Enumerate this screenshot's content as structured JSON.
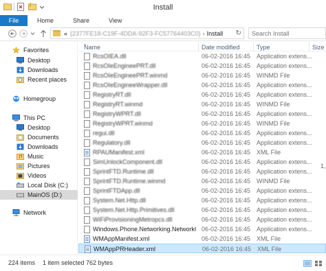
{
  "window": {
    "title": "Install"
  },
  "quick_access": {
    "items": [
      {
        "icon": "explorer-icon"
      },
      {
        "icon": "properties-icon"
      },
      {
        "icon": "new-folder-icon"
      },
      {
        "icon": "dropdown-icon"
      }
    ]
  },
  "ribbon": {
    "file_tab": "File",
    "tabs": [
      "Home",
      "Share",
      "View"
    ]
  },
  "address": {
    "back_icon": "back-arrow-icon",
    "forward_icon": "forward-arrow-icon",
    "up_icon": "up-arrow-icon",
    "overflow": "«",
    "crumb_hidden": "{2377FE18-C19F-4DDA-92F3-FC57764403C0}",
    "crumb": "Install",
    "search_placeholder": "Search Install"
  },
  "sidebar": {
    "favorites": "Favorites",
    "fav_items": [
      "Desktop",
      "Downloads",
      "Recent places"
    ],
    "homegroup": "Homegroup",
    "thispc": "This PC",
    "pc_items": [
      "Desktop",
      "Documents",
      "Downloads",
      "Music",
      "Pictures",
      "Videos",
      "Local Disk (C:)",
      "MainOS (D:)"
    ],
    "network": "Network"
  },
  "columns": {
    "name": "Name",
    "date": "Date modified",
    "type": "Type",
    "size": "Size"
  },
  "files": [
    {
      "name": "RcsOIEA.dll",
      "date": "06-02-2016 16:45",
      "type": "Application extens...",
      "blur": true,
      "xml": false
    },
    {
      "name": "RcsOIeEngineePRT.dll",
      "date": "06-02-2016 16:45",
      "type": "Application extens...",
      "blur": true,
      "xml": false
    },
    {
      "name": "RcsOIeEngineePRT.winmd",
      "date": "06-02-2016 16:45",
      "type": "WINMD File",
      "blur": true,
      "xml": false
    },
    {
      "name": "RcsOIeEngineeWrapper.dll",
      "date": "06-02-2016 16:45",
      "type": "Application extens...",
      "blur": true,
      "xml": false
    },
    {
      "name": "RegistryRT.dll",
      "date": "06-02-2016 16:45",
      "type": "Application extens...",
      "blur": true,
      "xml": false
    },
    {
      "name": "RegistryRT.winmd",
      "date": "06-02-2016 16:45",
      "type": "WINMD File",
      "blur": true,
      "xml": false
    },
    {
      "name": "RegistryWPRT.dll",
      "date": "06-02-2016 16:45",
      "type": "Application extens...",
      "blur": true,
      "xml": false
    },
    {
      "name": "RegistryWPRT.winmd",
      "date": "06-02-2016 16:45",
      "type": "WINMD File",
      "blur": true,
      "xml": false
    },
    {
      "name": "regui.dll",
      "date": "06-02-2016 16:45",
      "type": "Application extens...",
      "blur": true,
      "xml": false
    },
    {
      "name": "Regulatory.dll",
      "date": "06-02-2016 16:45",
      "type": "Application extens...",
      "blur": true,
      "xml": false
    },
    {
      "name": "RPAUManifest.xml",
      "date": "06-02-2016 16:45",
      "type": "XML File",
      "blur": true,
      "xml": true
    },
    {
      "name": "SimUnlockComponent.dll",
      "date": "06-02-2016 16:45",
      "type": "Application extens...",
      "blur": true,
      "xml": false
    },
    {
      "name": "SprintFTD.Runtime.dll",
      "date": "06-02-2016 16:45",
      "type": "Application extens...",
      "blur": true,
      "xml": false
    },
    {
      "name": "SprintFTD.Runtime.winmd",
      "date": "06-02-2016 16:45",
      "type": "WINMD File",
      "blur": true,
      "xml": false
    },
    {
      "name": "SprintFTDApp.dll",
      "date": "06-02-2016 16:45",
      "type": "Application extens...",
      "blur": true,
      "xml": false
    },
    {
      "name": "System.Net.Http.dll",
      "date": "06-02-2016 16:45",
      "type": "Application extens...",
      "blur": true,
      "xml": false
    },
    {
      "name": "System.Net.Http.Primitives.dll",
      "date": "06-02-2016 16:45",
      "type": "Application extens...",
      "blur": true,
      "xml": false
    },
    {
      "name": "WiFiProvisioningMetropcs.dll",
      "date": "06-02-2016 16:45",
      "type": "Application extens...",
      "blur": true,
      "xml": false
    },
    {
      "name": "Windows.Phone.Networking.NetworkOp...",
      "date": "06-02-2016 16:45",
      "type": "Application extens...",
      "blur": false,
      "xml": false
    },
    {
      "name": "WMAppManifest.xml",
      "date": "06-02-2016 16:45",
      "type": "XML File",
      "blur": false,
      "xml": true
    },
    {
      "name": "WMAppPRHeader.xml",
      "date": "06-02-2016 16:45",
      "type": "XML File",
      "blur": false,
      "xml": true,
      "selected": true
    }
  ],
  "size_glimpse": "1,",
  "status": {
    "count": "224 items",
    "selection": "1 item selected  762 bytes"
  },
  "colors": {
    "file_tab": "#1979ca",
    "selection": "#cce8ff",
    "selection_border": "#99d1ff",
    "header_text": "#4c607a"
  }
}
